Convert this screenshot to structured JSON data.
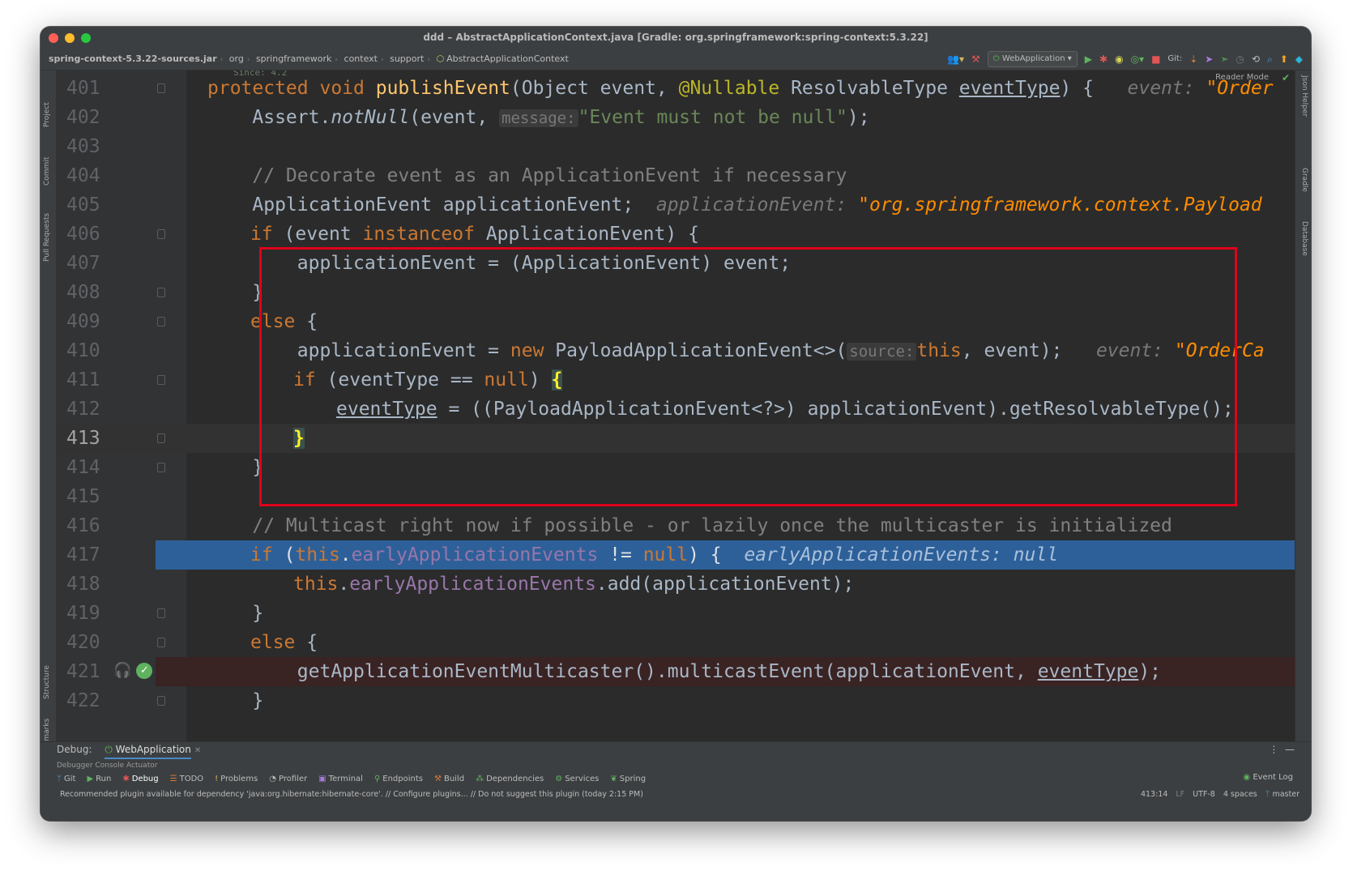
{
  "window": {
    "title": "ddd – AbstractApplicationContext.java [Gradle: org.springframework:spring-context:5.3.22]"
  },
  "breadcrumbs": [
    "spring-context-5.3.22-sources.jar",
    "org",
    "springframework",
    "context",
    "support",
    "AbstractApplicationContext"
  ],
  "toolbar": {
    "run_config": "WebApplication",
    "git_label": "Git:"
  },
  "left_tools": [
    "Project",
    "Commit",
    "Pull Requests",
    "Structure",
    "Bookmarks"
  ],
  "right_tools": [
    "Json Helper",
    "Gradle",
    "Database"
  ],
  "editor": {
    "since_doc": "Since:   4.2",
    "reader_mode": "Reader Mode",
    "line_numbers": [
      "401",
      "402",
      "403",
      "404",
      "405",
      "406",
      "407",
      "408",
      "409",
      "410",
      "411",
      "412",
      "413",
      "414",
      "415",
      "416",
      "417",
      "418",
      "419",
      "420",
      "421",
      "422"
    ],
    "hints": {
      "message": "message:",
      "source": "source:"
    },
    "text": {
      "l401_a": "protected void ",
      "l401_fn": "publishEvent",
      "l401_b": "(Object event, ",
      "l401_an": "@Nullable",
      "l401_c": " ResolvableType ",
      "l401_ul": "eventType",
      "l401_d": ") {   ",
      "l401_dbg": "event: ",
      "l401_dbgs": "\"Order",
      "l402_a": "    Assert.",
      "l402_it": "notNull",
      "l402_b": "(event, ",
      "l402_st": "\"Event must not be null\"",
      "l402_c": ");",
      "l404": "    // Decorate event as an ApplicationEvent if necessary",
      "l405_a": "    ApplicationEvent applicationEvent;  ",
      "l405_dbg": "applicationEvent: ",
      "l405_dbgs": "\"org.springframework.context.Payload",
      "l406_kw": "if",
      "l406_a": " (event ",
      "l406_kw2": "instanceof",
      "l406_b": " ApplicationEvent) {",
      "l407": "        applicationEvent = (ApplicationEvent) event;",
      "l408": "    }",
      "l409_kw": "else",
      "l409_b": " {",
      "l410_a": "        applicationEvent = ",
      "l410_kw": "new",
      "l410_b": " PayloadApplicationEvent<>(",
      "l410_kw2": "this",
      "l410_c": ", event);   ",
      "l410_dbg": "event: ",
      "l410_dbgs": "\"OrderCa",
      "l411_kw": "if",
      "l411_a": " (eventType == ",
      "l411_kw2": "null",
      "l411_b": ") ",
      "l411_br": "{",
      "l412_ul": "eventType",
      "l412_a": " = ((PayloadApplicationEvent<?>) applicationEvent).getResolvableType();",
      "l413_br": "}",
      "l414": "    }",
      "l416": "    // Multicast right now if possible - or lazily once the multicaster is initialized",
      "l417_kw": "if",
      "l417_a": " (",
      "l417_kw2": "this",
      "l417_b": ".",
      "l417_fld": "earlyApplicationEvents",
      "l417_c": " != ",
      "l417_kw3": "null",
      "l417_d": ") {  ",
      "l417_dbg": "earlyApplicationEvents: null",
      "l418_kw": "this",
      "l418_a": ".",
      "l418_fld": "earlyApplicationEvents",
      "l418_b": ".add(applicationEvent);",
      "l419": "    }",
      "l420_kw": "else",
      "l420_b": " {",
      "l421_a": "        getApplicationEventMulticaster().multicastEvent(applicationEvent, ",
      "l421_ul": "eventType",
      "l421_b": ");",
      "l422": "    }"
    }
  },
  "debug_panel": {
    "label": "Debug:",
    "tab": "WebApplication",
    "sub_tabs": "Debugger   Console   Actuator"
  },
  "tool_windows": [
    "Git",
    "Run",
    "Debug",
    "TODO",
    "Problems",
    "Profiler",
    "Terminal",
    "Endpoints",
    "Build",
    "Dependencies",
    "Services",
    "Spring"
  ],
  "event_log": "Event Log",
  "status": {
    "message": "Recommended plugin available for dependency 'java:org.hibernate:hibernate-core'. // Configure plugins... // Do not suggest this plugin (today 2:15 PM)",
    "position": "413:14",
    "line_sep": "LF",
    "encoding": "UTF-8",
    "indent": "4 spaces",
    "branch": "master"
  }
}
